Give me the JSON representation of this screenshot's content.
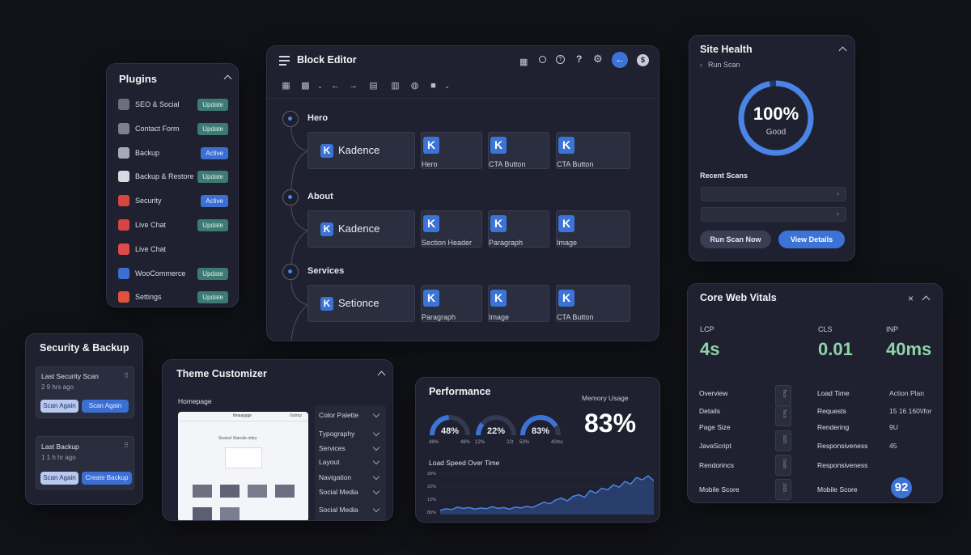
{
  "plugins": {
    "title": "Plugins",
    "items": [
      {
        "name": "SEO & Social",
        "status": "Update",
        "color": "#6b6f80"
      },
      {
        "name": "Contact Form",
        "status": "Update",
        "color": "#7c8092"
      },
      {
        "name": "Backup",
        "status": "Active",
        "color": "#a6a9b6"
      },
      {
        "name": "Backup & Restore",
        "status": "Update",
        "color": "#d8dae2"
      },
      {
        "name": "Security",
        "status": "Active",
        "color": "#d6473d"
      },
      {
        "name": "Live Chat",
        "status": "Update",
        "color": "#d64545"
      },
      {
        "name": "Live Chat",
        "status": "",
        "color": "#e04a4a"
      },
      {
        "name": "WooCommerce",
        "status": "Update",
        "color": "#3b6fd4"
      },
      {
        "name": "Settings",
        "status": "Update",
        "color": "#e0513e"
      }
    ]
  },
  "block_editor": {
    "title": "Block Editor",
    "sections": [
      {
        "name": "Hero",
        "main_tile": "Kadence",
        "tiles": [
          "Hero",
          "CTA Button",
          "CTA Button"
        ]
      },
      {
        "name": "About",
        "main_tile": "Kadence",
        "tiles": [
          "Section Header",
          "Paragraph",
          "Image"
        ]
      },
      {
        "name": "Services",
        "main_tile": "Setionce",
        "tiles": [
          "Paragraph",
          "Image",
          "CTA Button"
        ]
      }
    ],
    "k_glyph": "K"
  },
  "site_health": {
    "title": "Site Health",
    "run_scan_link": "Run Scan",
    "score": "100%",
    "score_label": "Good",
    "score_fraction": 1.0,
    "recent_title": "Recent Scans",
    "run_button": "Run Scan Now",
    "details_button": "View Details"
  },
  "security_backup": {
    "title": "Security & Backup",
    "scan_card": {
      "title": "Last Security Scan",
      "time": "2 9 hrs ago",
      "btn1": "Scan Again",
      "btn2": "Scan Again"
    },
    "backup_card": {
      "title": "Last Backup",
      "time": "1 1 h hr ago",
      "btn1": "Scan Again",
      "btn2": "Create Backup"
    }
  },
  "theme_customizer": {
    "title": "Theme Customizer",
    "section_label": "Homepage",
    "preview_title": "Ilmaaypge",
    "preview_meta": "//sdmp",
    "preview_hero": "Sostovl Starcde otdry",
    "menu": [
      "Color Palette",
      "Typography",
      "Services",
      "Layout",
      "Navigation",
      "Social Media",
      "Social Media"
    ]
  },
  "performance": {
    "title": "Performance",
    "memory_label": "Memory Usage",
    "memory_value": "83%",
    "gauges": [
      {
        "value": "48%",
        "fraction": 0.48,
        "left": "48%",
        "right": "48%"
      },
      {
        "value": "22%",
        "fraction": 0.22,
        "left": "12%",
        "right": "22t"
      },
      {
        "value": "83%",
        "fraction": 0.83,
        "left": "53%",
        "right": "40ms"
      }
    ],
    "chart_title": "Load Speed Over Time",
    "chart_data": {
      "type": "area",
      "ylabels": [
        "20%",
        "22%",
        "12%",
        "80%"
      ],
      "values": [
        10,
        14,
        12,
        18,
        15,
        17,
        13,
        16,
        14,
        19,
        15,
        17,
        13,
        18,
        16,
        20,
        17,
        24,
        30,
        26,
        35,
        40,
        33,
        44,
        48,
        42,
        58,
        52,
        64,
        60,
        72,
        66,
        80,
        74,
        90,
        84,
        94,
        82
      ]
    }
  },
  "core_web_vitals": {
    "title": "Core Web Vitals",
    "metrics": [
      {
        "label": "LCP",
        "value": "4s"
      },
      {
        "label": "CLS",
        "value": "0.01"
      },
      {
        "label": "INP",
        "value": "40ms"
      }
    ],
    "left_col": [
      "Overview",
      "Details",
      "Page Size",
      "JavaScript",
      "Rendorincs",
      "Mobile Score"
    ],
    "slots": [
      "Tech",
      "Tech",
      "3025",
      "Oadh",
      "3025"
    ],
    "mid_col": [
      "Load Time",
      "Requests",
      "Rendering",
      "Responsiveness",
      "Responsiveness",
      "Mobile Score"
    ],
    "right_col": [
      "Action Plan",
      "15 16 160\\/for",
      "9U",
      "45"
    ],
    "mobile_score": "92"
  }
}
